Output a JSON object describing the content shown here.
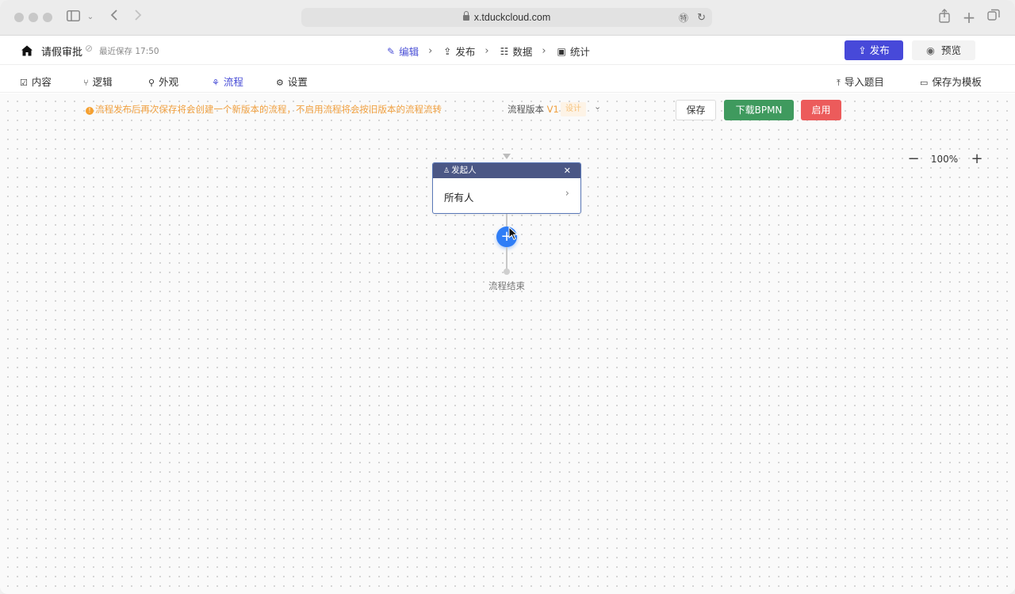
{
  "browser": {
    "url": "x.tduckcloud.com"
  },
  "header": {
    "form_title": "请假审批",
    "save_status": "最近保存 17:50",
    "steps": [
      {
        "label": "编辑",
        "icon": "edit-icon"
      },
      {
        "label": "发布",
        "icon": "upload-icon"
      },
      {
        "label": "数据",
        "icon": "list-icon"
      },
      {
        "label": "统计",
        "icon": "chart-icon"
      }
    ],
    "publish_label": "发布",
    "preview_label": "预览"
  },
  "subtabs": {
    "items": [
      {
        "label": "内容",
        "icon": "content-icon"
      },
      {
        "label": "逻辑",
        "icon": "logic-icon"
      },
      {
        "label": "外观",
        "icon": "brush-icon"
      },
      {
        "label": "流程",
        "icon": "flow-icon"
      },
      {
        "label": "设置",
        "icon": "gear-icon"
      }
    ],
    "import_label": "导入题目",
    "save_template_label": "保存为模板"
  },
  "flow": {
    "notice": "流程发布后再次保存将会创建一个新版本的流程，不启用流程将会按旧版本的流程流转",
    "version_label": "流程版本",
    "version_number": "V1",
    "version_tag": "设计",
    "save_label": "保存",
    "download_bpmn_label": "下载BPMN",
    "enable_label": "启用",
    "zoom": "100%",
    "node": {
      "title": "发起人",
      "assignee": "所有人"
    },
    "end_label": "流程结束"
  },
  "colors": {
    "accent": "#4749d9",
    "node_header": "#4b5785",
    "add_button": "#2f7df6",
    "download": "#3f9a5e",
    "enable": "#ec5b5b",
    "notice": "#f0a040"
  }
}
